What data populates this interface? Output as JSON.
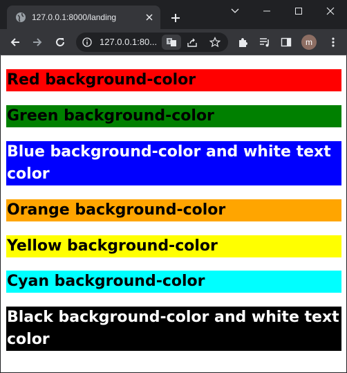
{
  "browser": {
    "tab_title": "127.0.0.1:8000/landing",
    "address": "127.0.0.1:80...",
    "profile_initial": "m"
  },
  "page": {
    "blocks": [
      {
        "text": "Red background-color",
        "bg": "#ff0000",
        "fg": "#000000"
      },
      {
        "text": "Green background-color",
        "bg": "#008000",
        "fg": "#000000"
      },
      {
        "text": "Blue background-color and white text color",
        "bg": "#0000ff",
        "fg": "#ffffff"
      },
      {
        "text": "Orange background-color",
        "bg": "#ffa500",
        "fg": "#000000"
      },
      {
        "text": "Yellow background-color",
        "bg": "#ffff00",
        "fg": "#000000"
      },
      {
        "text": "Cyan background-color",
        "bg": "#00ffff",
        "fg": "#000000"
      },
      {
        "text": "Black background-color and white text color",
        "bg": "#000000",
        "fg": "#ffffff"
      }
    ]
  }
}
